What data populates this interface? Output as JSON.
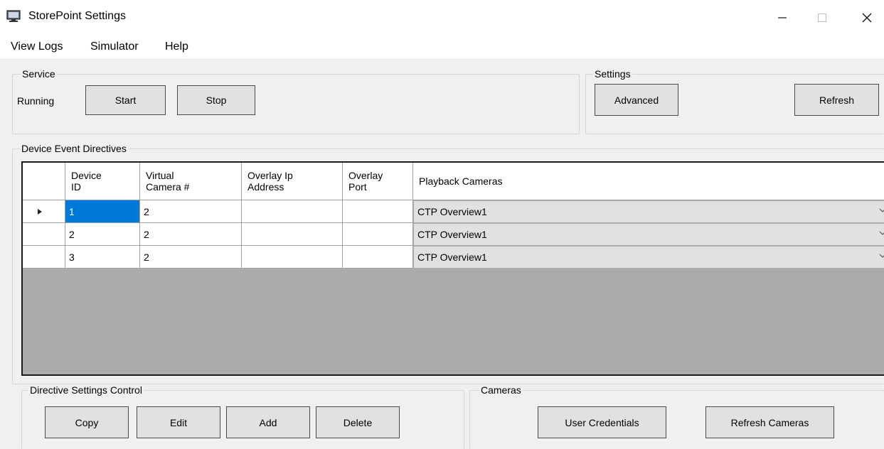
{
  "window": {
    "title": "StorePoint Settings",
    "icon": "monitor-icon",
    "controls": {
      "minimize": "minimize-icon",
      "maximize": "maximize-icon",
      "close": "close-icon"
    }
  },
  "menu": {
    "items": [
      "View Logs",
      "Simulator",
      "Help"
    ]
  },
  "service": {
    "label": "Service",
    "status": "Running",
    "start_label": "Start",
    "stop_label": "Stop"
  },
  "settings": {
    "label": "Settings",
    "advanced_label": "Advanced",
    "refresh_label": "Refresh"
  },
  "directives": {
    "label": "Device Event Directives",
    "columns": [
      [
        "Device",
        "ID"
      ],
      [
        "Virtual",
        "Camera #"
      ],
      [
        "Overlay Ip",
        "Address"
      ],
      [
        "Overlay",
        "Port"
      ],
      [
        "Playback Cameras"
      ]
    ],
    "rows": [
      {
        "device_id": "1",
        "virtual_camera": "2",
        "overlay_ip": "",
        "overlay_port": "",
        "playback_camera": "CTP Overview1"
      },
      {
        "device_id": "2",
        "virtual_camera": "2",
        "overlay_ip": "",
        "overlay_port": "",
        "playback_camera": "CTP Overview1"
      },
      {
        "device_id": "3",
        "virtual_camera": "2",
        "overlay_ip": "",
        "overlay_port": "",
        "playback_camera": "CTP Overview1"
      }
    ]
  },
  "directive_control": {
    "label": "Directive Settings Control",
    "copy_label": "Copy",
    "edit_label": "Edit",
    "add_label": "Add",
    "delete_label": "Delete"
  },
  "cameras": {
    "label": "Cameras",
    "user_credentials_label": "User Credentials",
    "refresh_cameras_label": "Refresh Cameras"
  },
  "colors": {
    "selection": "#0078d7",
    "grid_background": "#ababab",
    "button_face": "#e1e1e1"
  }
}
